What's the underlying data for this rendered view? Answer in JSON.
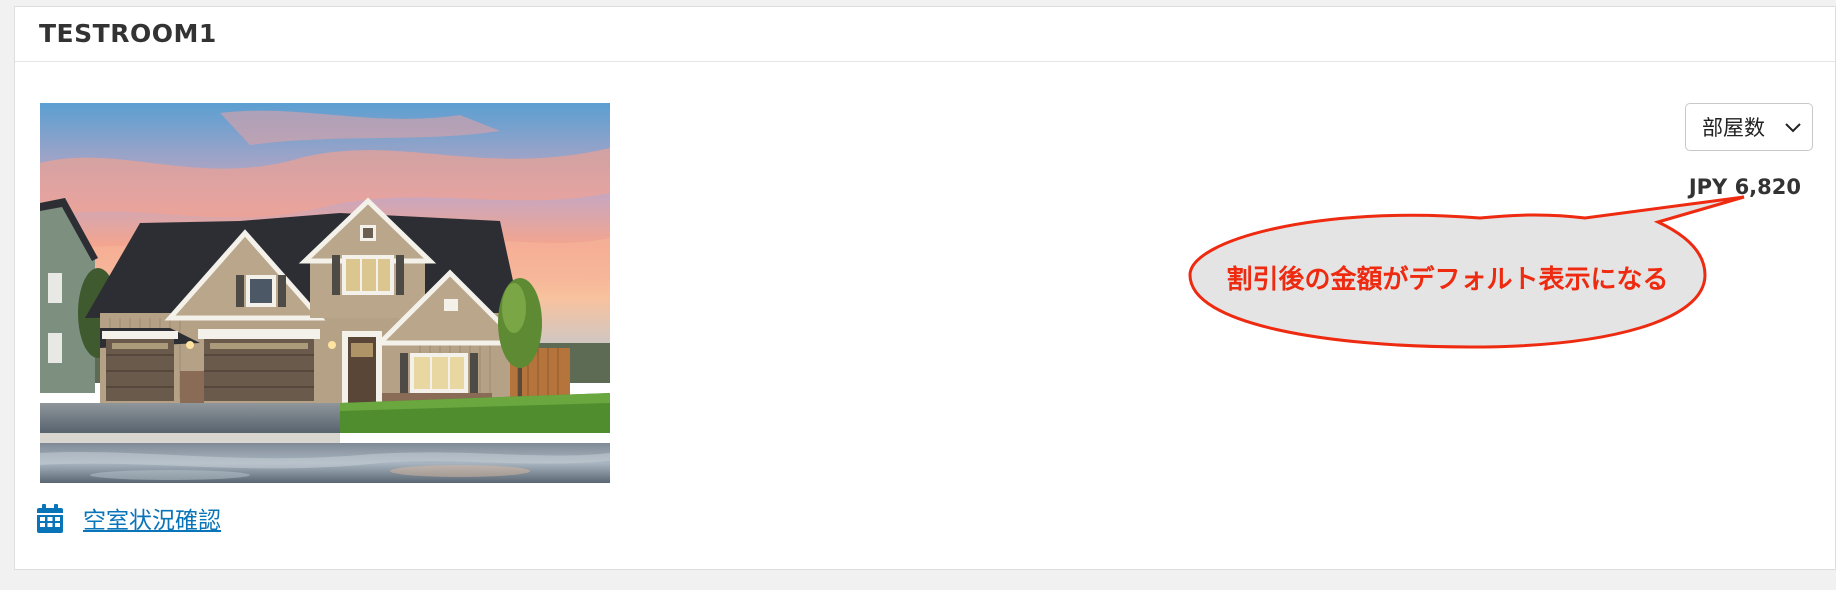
{
  "room": {
    "title": "TESTROOM1"
  },
  "photo": {
    "alt": "Two-story house with three garage doors at sunset",
    "colors": {
      "sky_top": "#5a9fd0",
      "sky_pink": "#f0a090",
      "roof": "#2c2e33",
      "siding": "#b6a38a",
      "trim": "#f4f1ea",
      "garage": "#6a5a4c",
      "driveway": "#767e86",
      "lawn": "#4f8d2f"
    }
  },
  "availability": {
    "icon": "calendar-icon",
    "link_label": "空室状況確認"
  },
  "rooms_select": {
    "label": "部屋数",
    "icon": "chevron-down-icon"
  },
  "price": {
    "text": "JPY 6,820"
  },
  "callout": {
    "text": "割引後の金額がデフォルト表示になる",
    "fill": "#e4e4e4",
    "stroke": "#ee2a10"
  },
  "colors": {
    "link": "#0a74b8",
    "title": "#333333",
    "annotation": "#ee2a10",
    "background": "#f1f1f1",
    "panel": "#ffffff"
  }
}
